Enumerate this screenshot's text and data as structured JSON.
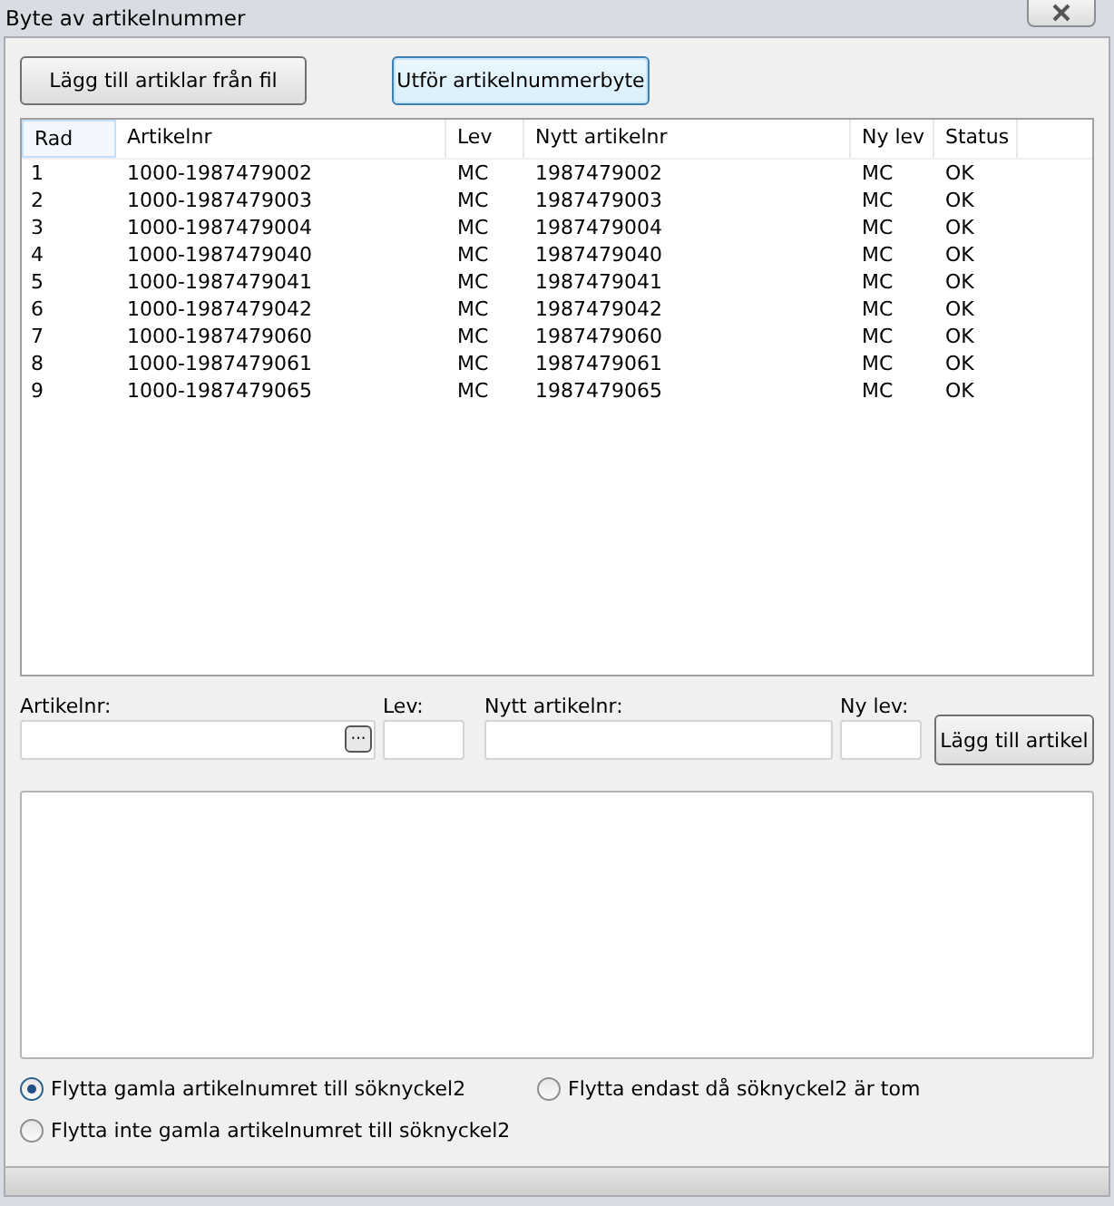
{
  "window": {
    "title": "Byte av artikelnummer"
  },
  "buttons": [
    {
      "label": "Lägg till artiklar från fil",
      "focused": false
    },
    {
      "label": "Utför artikelnummerbyte",
      "focused": true
    }
  ],
  "table": {
    "columns": [
      "Rad",
      "Artikelnr",
      "Lev",
      "Nytt artikelnr",
      "Ny lev",
      "Status"
    ],
    "rows": [
      [
        "1",
        "1000-1987479002",
        "MC",
        "1987479002",
        "MC",
        "OK"
      ],
      [
        "2",
        "1000-1987479003",
        "MC",
        "1987479003",
        "MC",
        "OK"
      ],
      [
        "3",
        "1000-1987479004",
        "MC",
        "1987479004",
        "MC",
        "OK"
      ],
      [
        "4",
        "1000-1987479040",
        "MC",
        "1987479040",
        "MC",
        "OK"
      ],
      [
        "5",
        "1000-1987479041",
        "MC",
        "1987479041",
        "MC",
        "OK"
      ],
      [
        "6",
        "1000-1987479042",
        "MC",
        "1987479042",
        "MC",
        "OK"
      ],
      [
        "7",
        "1000-1987479060",
        "MC",
        "1987479060",
        "MC",
        "OK"
      ],
      [
        "8",
        "1000-1987479061",
        "MC",
        "1987479061",
        "MC",
        "OK"
      ],
      [
        "9",
        "1000-1987479065",
        "MC",
        "1987479065",
        "MC",
        "OK"
      ]
    ]
  },
  "form": {
    "fields": [
      {
        "label": "Artikelnr:",
        "browse_button": "···"
      },
      {
        "label": "Lev:"
      },
      {
        "label": "Nytt artikelnr:"
      },
      {
        "label": "Ny lev:"
      }
    ],
    "add_button": "Lägg till artikel"
  },
  "options": [
    {
      "label": "Flytta gamla artikelnumret till söknyckel2",
      "selected": true
    },
    {
      "label": "Flytta endast då söknyckel2 är tom",
      "selected": false
    },
    {
      "label": "Flytta inte gamla artikelnumret till söknyckel2",
      "selected": false
    }
  ]
}
